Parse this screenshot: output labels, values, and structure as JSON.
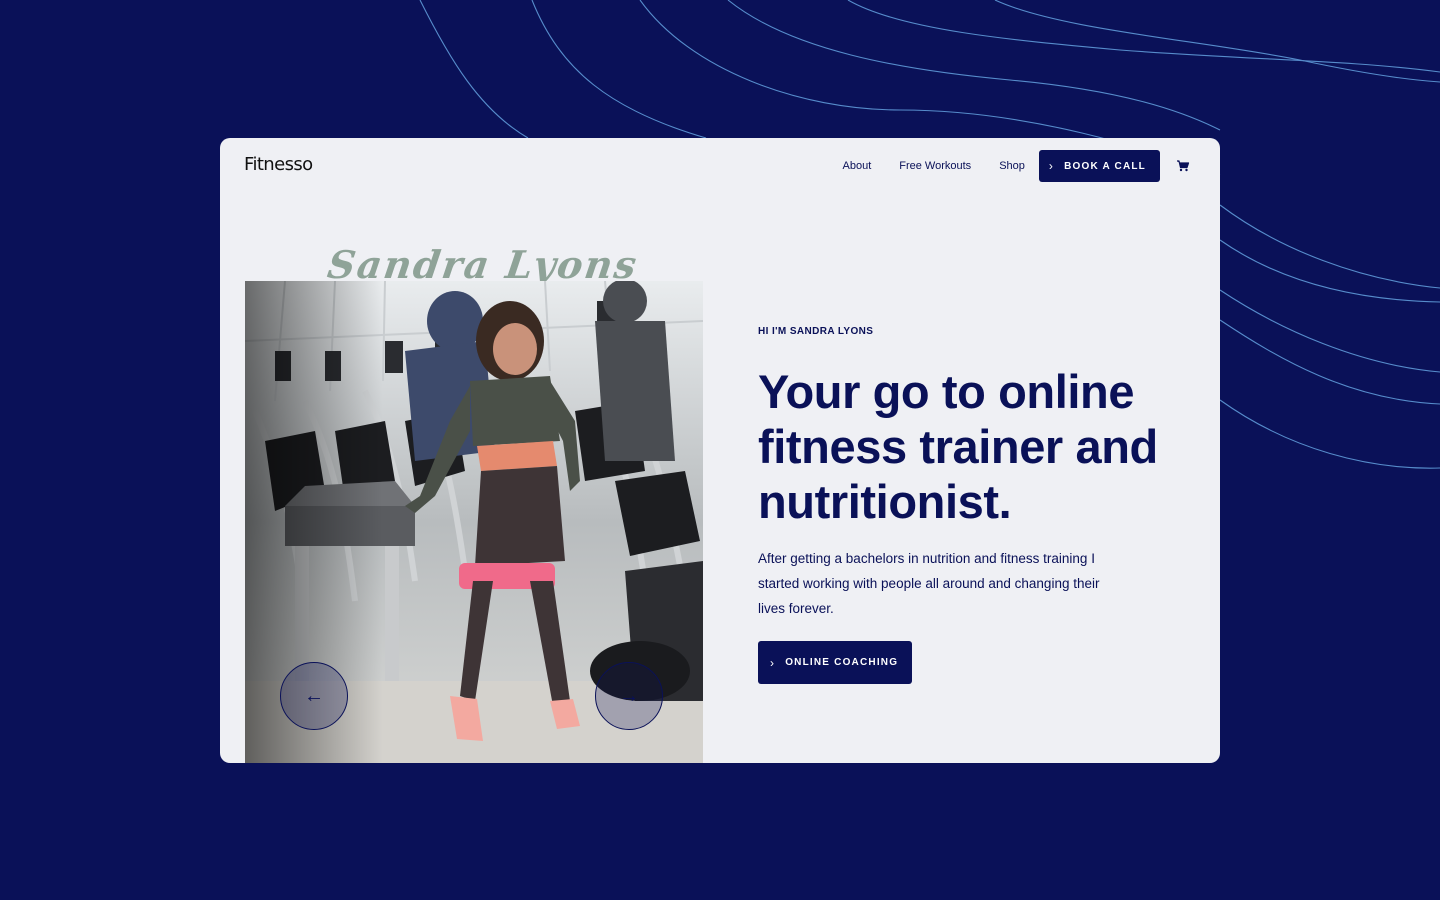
{
  "brand": {
    "logo": "Fitnesso"
  },
  "nav": {
    "items": [
      "About",
      "Free Workouts",
      "Shop"
    ],
    "cta_label": "BOOK A CALL",
    "cart_icon": "cart-icon"
  },
  "hero": {
    "script_name": "Sandra Lyons",
    "eyebrow": "HI I'M SANDRA LYONS",
    "headline": "Your go to online fitness trainer and nutritionist.",
    "paragraph": "After getting a bachelors in nutrition and fitness training I started working with people all around and changing their lives forever.",
    "cta_label": "ONLINE COACHING",
    "prev_icon": "arrow-left-icon",
    "next_icon": "arrow-right-icon"
  },
  "colors": {
    "background": "#0a1158",
    "card": "#eff0f4",
    "primary": "#0a1158",
    "script": "#8fa398",
    "lines": "#6ea8e0"
  }
}
